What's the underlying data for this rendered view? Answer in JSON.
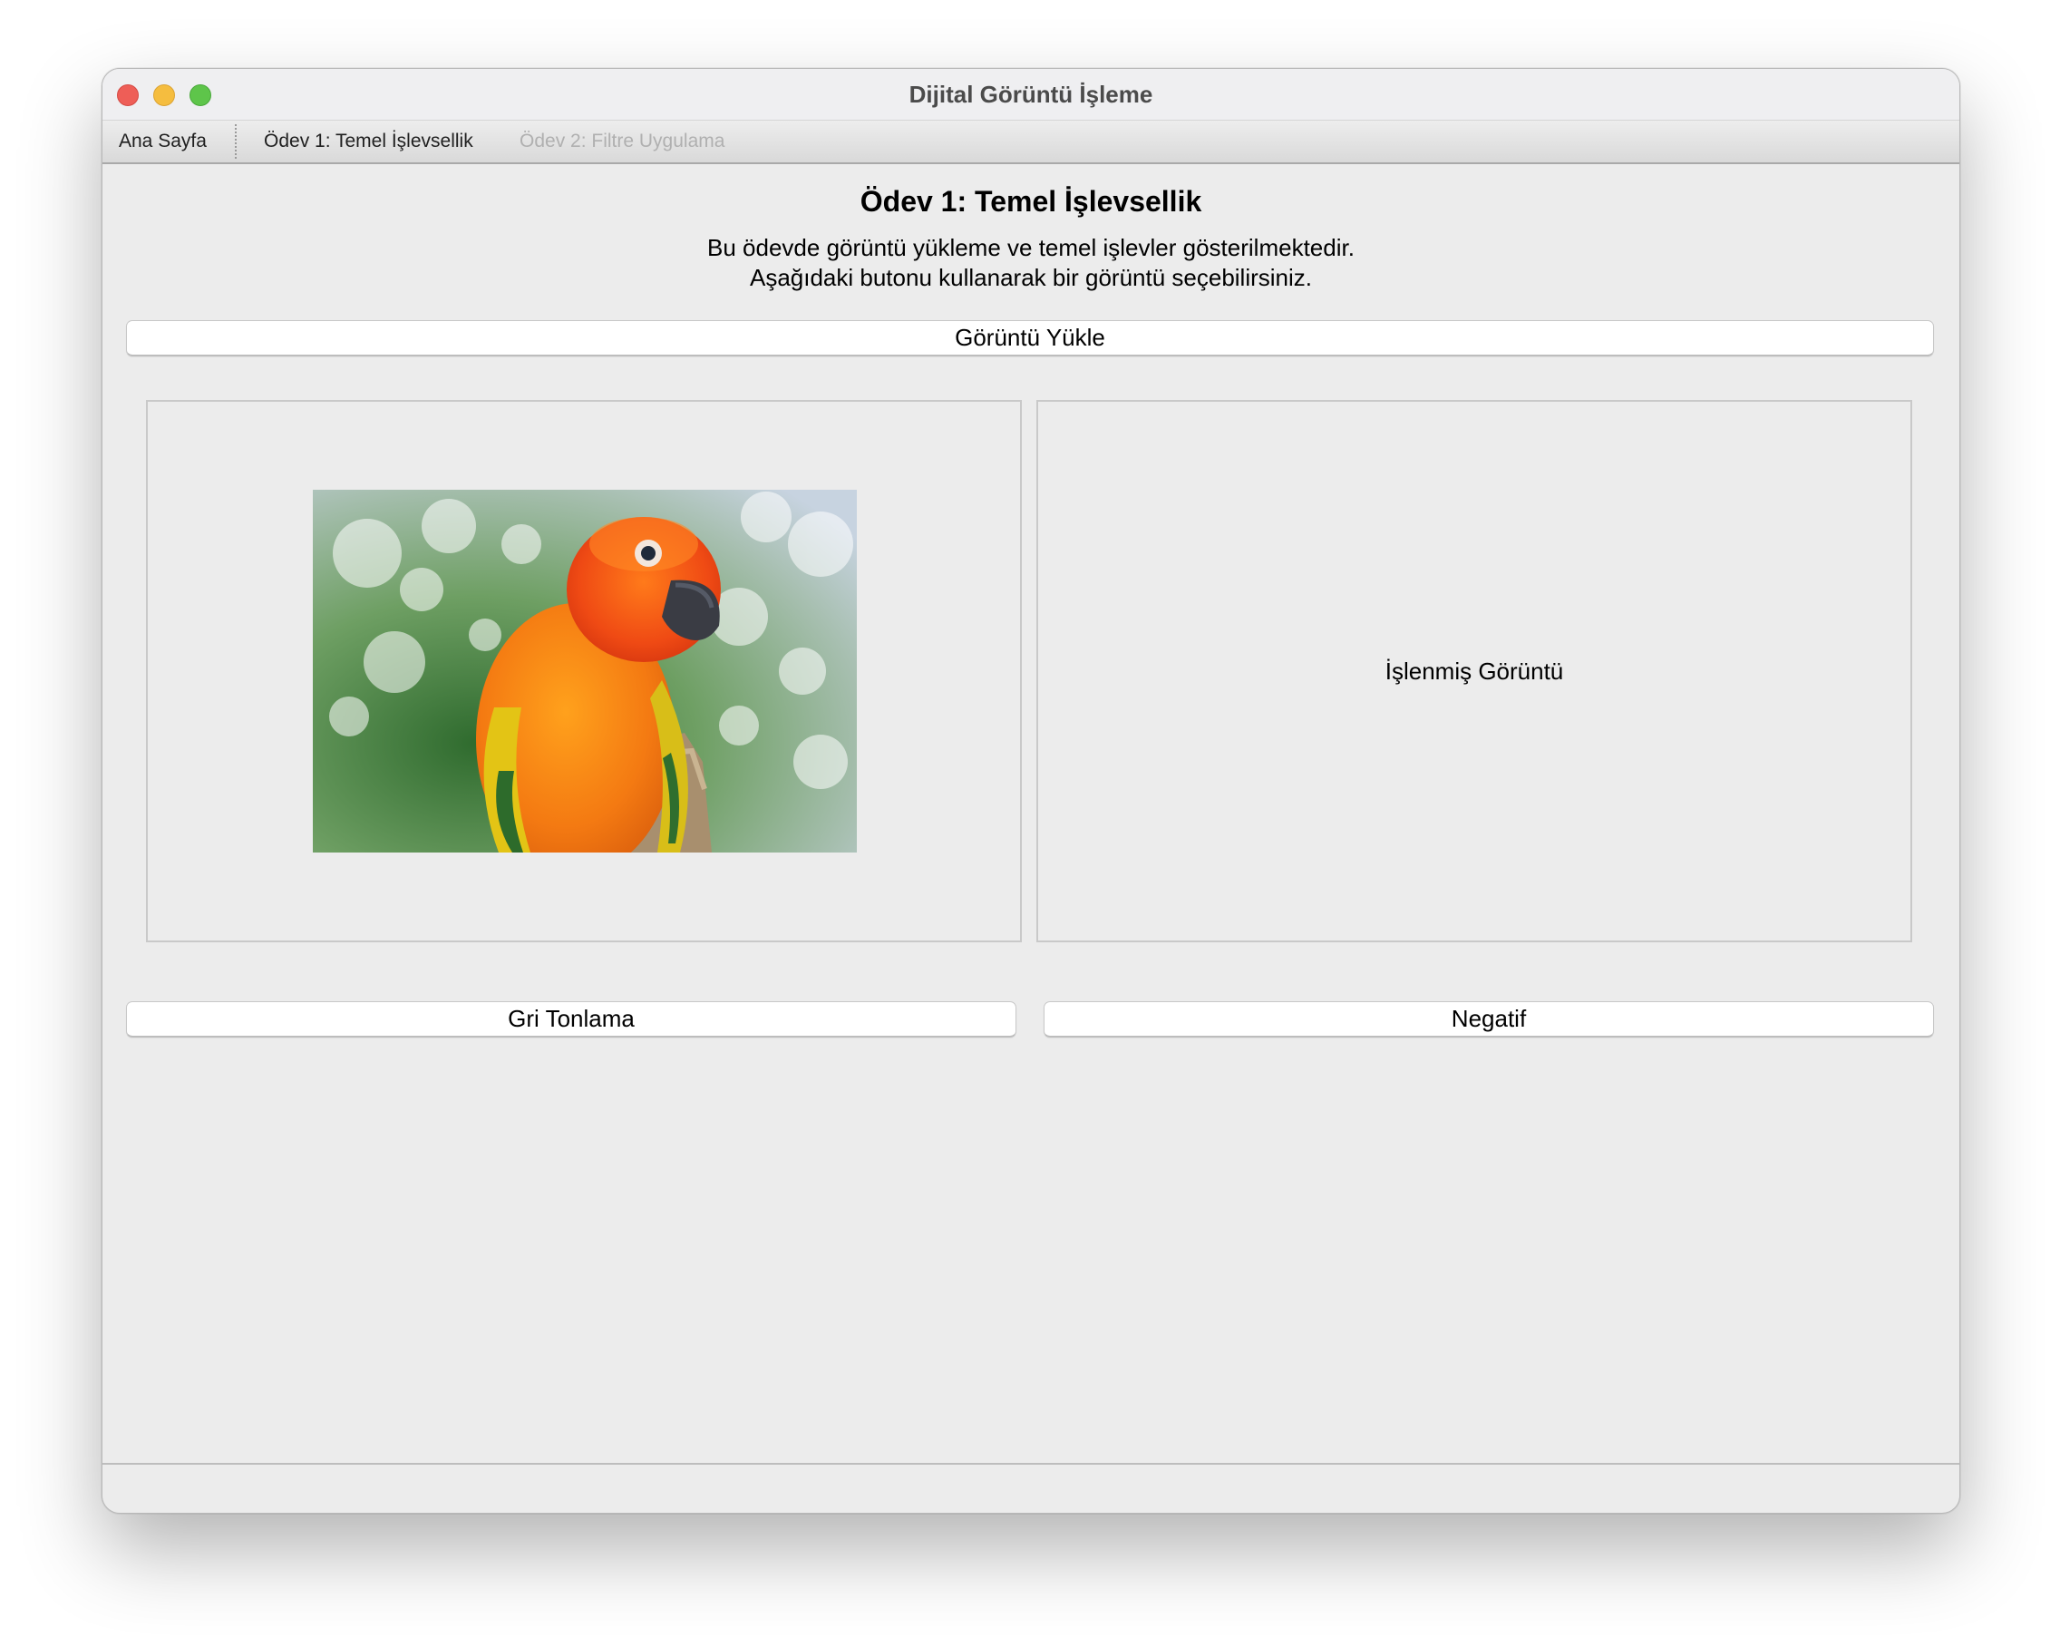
{
  "window": {
    "title": "Dijital Görüntü İşleme"
  },
  "tabs": [
    {
      "label": "Ana Sayfa",
      "enabled": true
    },
    {
      "label": "Ödev 1: Temel İşlevsellik",
      "enabled": true
    },
    {
      "label": "Ödev 2: Filtre Uygulama",
      "enabled": false
    }
  ],
  "page": {
    "heading": "Ödev 1: Temel İşlevsellik",
    "description_line1": "Bu ödevde görüntü yükleme ve temel işlevler gösterilmektedir.",
    "description_line2": "Aşağıdaki butonu kullanarak bir görüntü seçebilirsiniz."
  },
  "buttons": {
    "load": "Görüntü Yükle",
    "grayscale": "Gri Tonlama",
    "negative": "Negatif"
  },
  "panels": {
    "processed_label": "İşlenmiş Görüntü"
  },
  "colors": {
    "close": "#ee5e57",
    "minimize": "#f5bd3f",
    "maximize": "#5ec54a",
    "window_bg": "#ececec"
  }
}
